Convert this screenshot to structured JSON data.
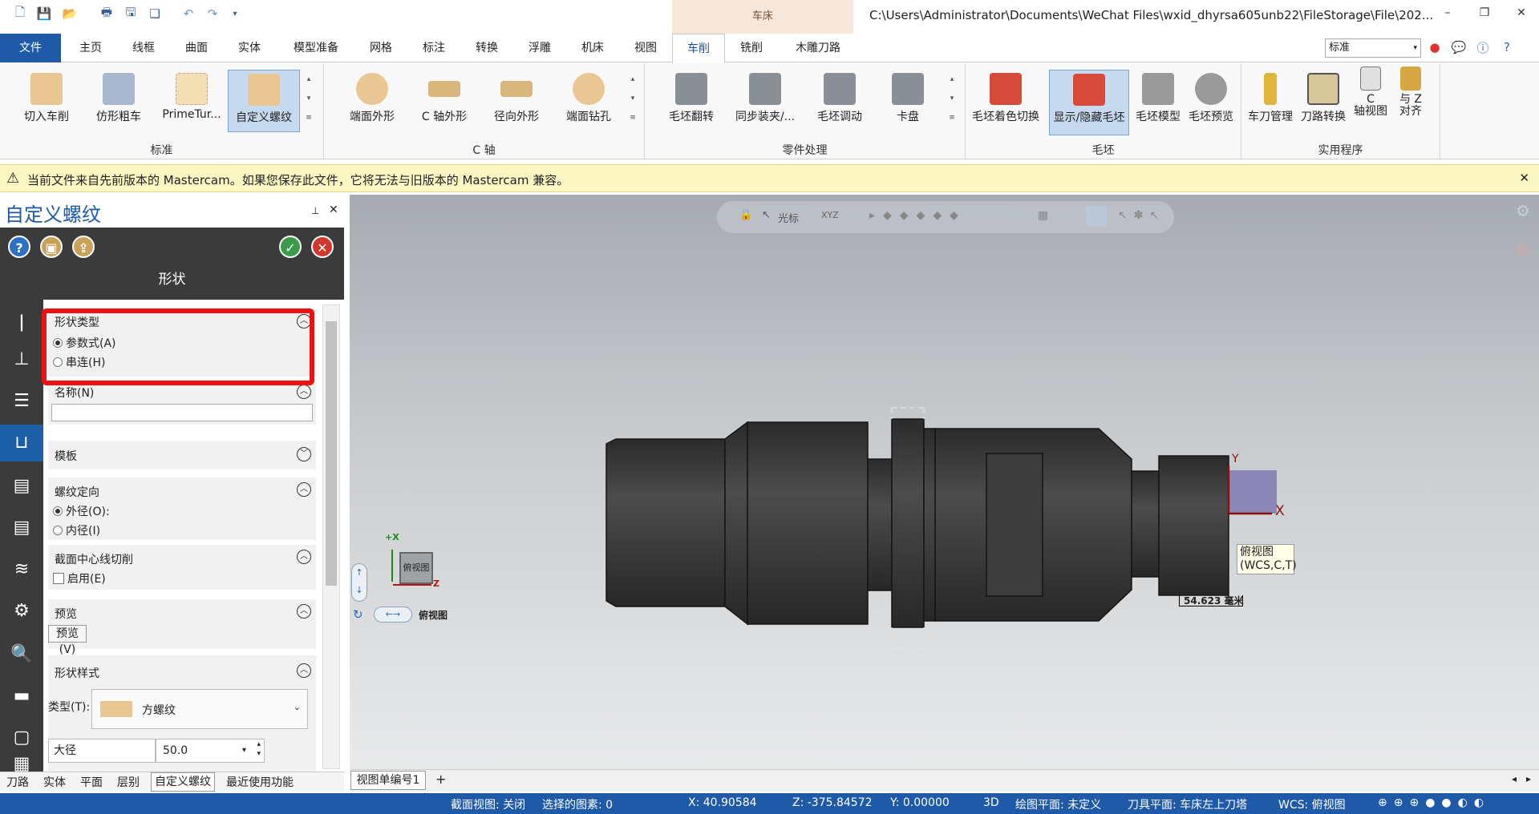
{
  "title_bar": {
    "context_tab": "车床",
    "window_title": "C:\\Users\\Administrator\\Documents\\WeChat Files\\wxid_dhyrsa605unb22\\FileStorage\\File\\202...",
    "quick_access_icons": [
      "new-icon",
      "save-icon",
      "open-icon",
      "print-icon",
      "save-as-icon",
      "copy-icon",
      "undo-icon",
      "redo-icon",
      "customize-icon"
    ],
    "min": "–",
    "restore": "❐",
    "close": "✕"
  },
  "tabs": [
    "文件",
    "主页",
    "线框",
    "曲面",
    "实体",
    "模型准备",
    "网格",
    "标注",
    "转换",
    "浮雕",
    "机床",
    "视图",
    "车削",
    "铣削",
    "木雕刀路"
  ],
  "active_tab": "车削",
  "style_select": "标准",
  "ribbon": {
    "groups": [
      {
        "label": "标准",
        "buttons": [
          "切入车削",
          "仿形粗车",
          "PrimeTur...",
          "自定义螺纹"
        ]
      },
      {
        "label": "C 轴",
        "buttons": [
          "端面外形",
          "C 轴外形",
          "径向外形",
          "端面钻孔"
        ]
      },
      {
        "label": "零件处理",
        "buttons": [
          "毛坯翻转",
          "同步装夹/...",
          "毛坯调动",
          "卡盘"
        ]
      },
      {
        "label": "毛坯",
        "buttons": [
          "毛坯着色切换",
          "显示/隐藏毛坯",
          "毛坯模型",
          "毛坯预览"
        ]
      },
      {
        "label": "实用程序",
        "buttons": [
          "车刀管理",
          "刀路转换",
          "C\n轴视图",
          "与 Z\n对齐"
        ]
      }
    ]
  },
  "warning": {
    "text": "当前文件来自先前版本的 Mastercam。如果您保存此文件，它将无法与旧版本的 Mastercam 兼容。",
    "close": "✕"
  },
  "panel": {
    "title": "自定义螺纹",
    "pin": "📌",
    "close": "✕",
    "header": "形状",
    "sections": {
      "shape_type": {
        "label": "形状类型",
        "options": [
          "参数式(A)",
          "串连(H)"
        ],
        "selected": 0
      },
      "name": {
        "label": "名称(N)",
        "value": ""
      },
      "template": {
        "label": "模板"
      },
      "thread_orientation": {
        "label": "螺纹定向",
        "options": [
          "外径(O):",
          "内径(I)"
        ],
        "selected": 0
      },
      "centerline": {
        "label": "截面中心线切削",
        "checkbox": "启用(E)",
        "checked": false
      },
      "preview": {
        "label": "预览",
        "button": "预览(V)"
      },
      "shape_style": {
        "label": "形状样式",
        "type_label": "类型(T):",
        "type_value": "方螺纹"
      },
      "major_dia": {
        "label": "大径",
        "value": "50.0"
      }
    },
    "bottom_tabs": [
      "刀路",
      "实体",
      "平面",
      "层别",
      "自定义螺纹",
      "最近使用功能"
    ],
    "active_bottom_tab": "自定义螺纹"
  },
  "viewport": {
    "toolbar_label": "光标",
    "view_label": "俯视图\n(WCS,C,T)",
    "axis_x": "X",
    "axis_y": "Y",
    "cube_label": "俯视图",
    "cube_x": "+X",
    "cube_z": "Z",
    "nav_label": "俯视图",
    "scale": "54.623 毫米",
    "viewsheet": "视图单编号1",
    "add_sheet": "+"
  },
  "status": {
    "section_view": "截面视图: 关闭",
    "selected": "选择的图素: 0",
    "x": "X:   40.90584",
    "z": "Z:   -375.84572",
    "y": "Y:   0.00000",
    "mode": "3D",
    "cplane": "绘图平面: 未定义",
    "tplane": "刀具平面: 车床左上刀塔",
    "wcs": "WCS: 俯视图"
  }
}
